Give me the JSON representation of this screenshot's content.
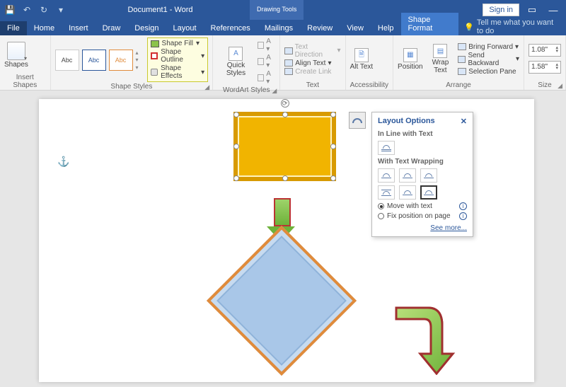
{
  "titlebar": {
    "title": "Document1 - Word",
    "tools_label": "Drawing Tools",
    "signin": "Sign in"
  },
  "tabs": {
    "file": "File",
    "home": "Home",
    "insert": "Insert",
    "draw": "Draw",
    "design": "Design",
    "layout": "Layout",
    "references": "References",
    "mailings": "Mailings",
    "review": "Review",
    "view": "View",
    "help": "Help",
    "shape_format": "Shape Format",
    "tellme": "Tell me what you want to do"
  },
  "ribbon": {
    "insert_shapes": {
      "button": "Shapes",
      "label": "Insert Shapes"
    },
    "shape_styles": {
      "label": "Shape Styles",
      "sample": "Abc",
      "fill": "Shape Fill",
      "outline": "Shape Outline",
      "effects": "Shape Effects"
    },
    "wordart": {
      "label": "WordArt Styles",
      "quick": "Quick Styles"
    },
    "text": {
      "label": "Text",
      "dir": "Text Direction",
      "align": "Align Text",
      "link": "Create Link"
    },
    "accessibility": {
      "label": "Accessibility",
      "alt": "Alt Text"
    },
    "arrange": {
      "label": "Arrange",
      "position": "Position",
      "wrap": "Wrap Text",
      "bring": "Bring Forward",
      "send": "Send Backward",
      "pane": "Selection Pane"
    },
    "size": {
      "label": "Size",
      "height": "1.08\"",
      "width": "1.58\""
    }
  },
  "flyout": {
    "title": "Layout Options",
    "inline": "In Line with Text",
    "wrap": "With Text Wrapping",
    "move": "Move with text",
    "fix": "Fix position on page",
    "seemore": "See more..."
  }
}
